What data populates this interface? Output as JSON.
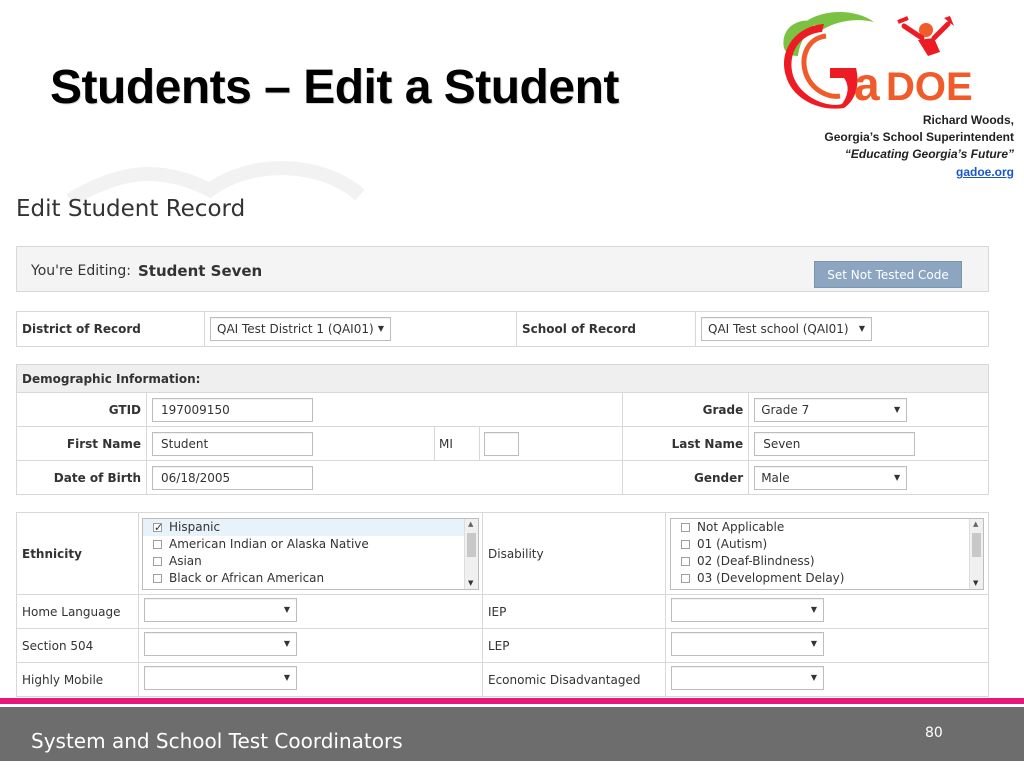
{
  "slide": {
    "title": "Students – Edit a Student"
  },
  "logo": {
    "wordmark": "GaDOE",
    "lines": [
      "Richard Woods,",
      "Georgia’s School Superintendent",
      "“Educating Georgia’s Future”"
    ],
    "link": "gadoe.org",
    "colors": {
      "green": "#7cc242",
      "orange": "#f15a29",
      "red": "#ed1c24",
      "pink": "#e7187b"
    }
  },
  "form": {
    "heading": "Edit Student Record",
    "editing_label": "You're Editing:",
    "editing_name": "Student Seven",
    "set_not_tested_button": "Set Not Tested Code",
    "district_label": "District of Record",
    "district_value": "QAI Test District 1 (QAI01)",
    "school_label": "School of Record",
    "school_value": "QAI Test school (QAI01)",
    "demographic_header": "Demographic Information:",
    "gtid_label": "GTID",
    "gtid_value": "197009150",
    "grade_label": "Grade",
    "grade_value": "Grade 7",
    "first_name_label": "First Name",
    "first_name_value": "Student",
    "mi_label": "MI",
    "mi_value": "",
    "last_name_label": "Last Name",
    "last_name_value": "Seven",
    "dob_label": "Date of Birth",
    "dob_value": "06/18/2005",
    "gender_label": "Gender",
    "gender_value": "Male",
    "ethnicity_label": "Ethnicity",
    "ethnicity_options": [
      {
        "label": "Hispanic",
        "checked": true
      },
      {
        "label": "American Indian or Alaska Native",
        "checked": false
      },
      {
        "label": "Asian",
        "checked": false
      },
      {
        "label": "Black or African American",
        "checked": false
      }
    ],
    "disability_label": "Disability",
    "disability_options": [
      {
        "label": "Not Applicable",
        "checked": false
      },
      {
        "label": "01 (Autism)",
        "checked": false
      },
      {
        "label": "02 (Deaf-Blindness)",
        "checked": false
      },
      {
        "label": "03 (Development Delay)",
        "checked": false
      }
    ],
    "home_language_label": "Home Language",
    "home_language_value": "",
    "iep_label": "IEP",
    "iep_value": "",
    "section504_label": "Section 504",
    "section504_value": "",
    "lep_label": "LEP",
    "lep_value": "",
    "highly_mobile_label": "Highly Mobile",
    "highly_mobile_value": "",
    "econ_disadv_label": "Economic Disadvantaged",
    "econ_disadv_value": ""
  },
  "footer": {
    "text": "System and School Test Coordinators",
    "page_number": "80",
    "bar_color": "#6d6d6d",
    "accent_line_color": "#e7187b"
  }
}
